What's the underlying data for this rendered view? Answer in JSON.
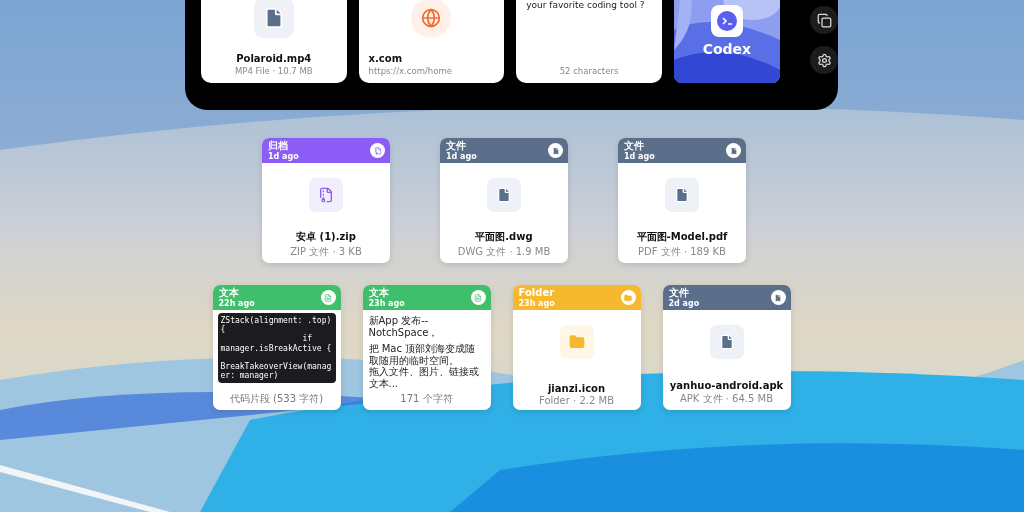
{
  "top_panel": {
    "items": [
      {
        "kind": "file",
        "name": "Polaroid.mp4",
        "meta": "MP4 File · 10.7 MB"
      },
      {
        "kind": "link",
        "title": "x.com",
        "url": "https://x.com/home"
      },
      {
        "kind": "text",
        "text": "your favorite coding tool ?",
        "count": "52 characters"
      },
      {
        "caption": "Codex"
      }
    ],
    "side_buttons": [
      {
        "kind": "copy"
      },
      {
        "kind": "settings"
      }
    ]
  },
  "shelf_rows": [
    [
      {
        "kind": "archive",
        "category": "归档",
        "time": "1d ago",
        "color": "#8b5cf6",
        "name": "安卓 (1).zip",
        "meta": "ZIP 文件 · 3 KB"
      },
      {
        "kind": "file",
        "category": "文件",
        "time": "1d ago",
        "color": "#5b6f8a",
        "name": "平面图.dwg",
        "meta": "DWG 文件 · 1.9 MB"
      },
      {
        "kind": "file",
        "category": "文件",
        "time": "1d ago",
        "color": "#5b6f8a",
        "name": "平面图-Model.pdf",
        "meta": "PDF 文件 · 189 KB"
      }
    ],
    [
      {
        "kind": "code",
        "category": "文本",
        "time": "22h ago",
        "color": "#3fbf6b",
        "code": "ZStack(alignment: .top)\n{\n                 if\nmanager.isBreakActive {\n\nBreakTakeoverView(manager: manager)",
        "footer": "代码片段 (533 字符)"
      },
      {
        "kind": "text",
        "category": "文本",
        "time": "23h ago",
        "color": "#3fbf6b",
        "paragraphs": [
          "新App 发布--NotchSpace，",
          "把 Mac 顶部刘海变成随取随用的临时空间。",
          "拖入文件、图片、链接或文本..."
        ],
        "footer": "171 个字符"
      },
      {
        "kind": "folder",
        "category": "Folder",
        "time": "23h ago",
        "color": "#f5b82e",
        "name": "jianzi.icon",
        "meta": "Folder · 2.2 MB"
      },
      {
        "kind": "file",
        "category": "文件",
        "time": "2d ago",
        "color": "#5b6f8a",
        "name": "yanhuo-android.apk",
        "meta": "APK 文件 · 64.5 MB"
      }
    ]
  ]
}
